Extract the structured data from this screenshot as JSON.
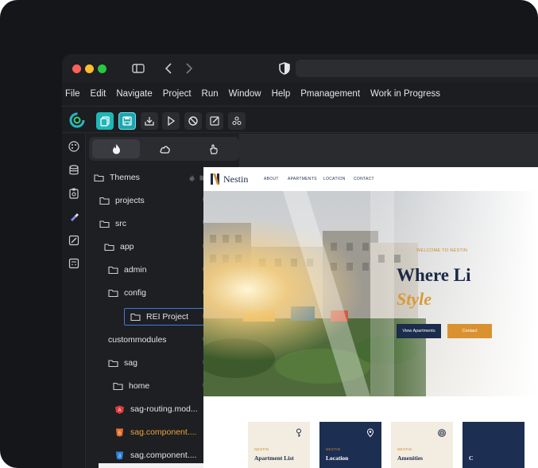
{
  "menubar": {
    "items": [
      "File",
      "Edit",
      "Navigate",
      "Project",
      "Run",
      "Window",
      "Help",
      "Pmanagement",
      "Work in Progress"
    ]
  },
  "explorer": {
    "tree": [
      {
        "label": "Themes"
      },
      {
        "label": "projects"
      },
      {
        "label": "src"
      },
      {
        "label": "app"
      },
      {
        "label": "admin"
      },
      {
        "label": "config"
      },
      {
        "label": "REI Project"
      },
      {
        "label": "custommodules"
      },
      {
        "label": "sag"
      },
      {
        "label": "home"
      },
      {
        "label": "sag-routing.mod..."
      },
      {
        "label": "sag.component...."
      },
      {
        "label": "sag.component...."
      }
    ]
  },
  "site": {
    "brand": "Nestin",
    "nav": [
      "ABOUT",
      "APARTMENTS",
      "LOCATION",
      "CONTACT"
    ],
    "hero": {
      "tag": "WELCOME TO NESTIN",
      "title_line1": "Where Li",
      "title_line2": "Style",
      "btn_primary": "View Apartments",
      "btn_secondary": "Contact"
    },
    "cards": [
      {
        "tag": "NESTIN",
        "title": "Apartment List"
      },
      {
        "tag": "NESTIN",
        "title": "Location"
      },
      {
        "tag": "NESTIN",
        "title": "Amenities"
      },
      {
        "tag": "",
        "title": "C"
      }
    ]
  },
  "colors": {
    "accent_teal": "#1fb6b8",
    "navy": "#1b2c4c",
    "gold": "#d9922f",
    "selection_border": "#3d7ae0",
    "angular_red": "#dd3b3b",
    "html_orange": "#e8702a",
    "css_blue": "#2d84e0",
    "orange_text": "#e8a23b"
  }
}
